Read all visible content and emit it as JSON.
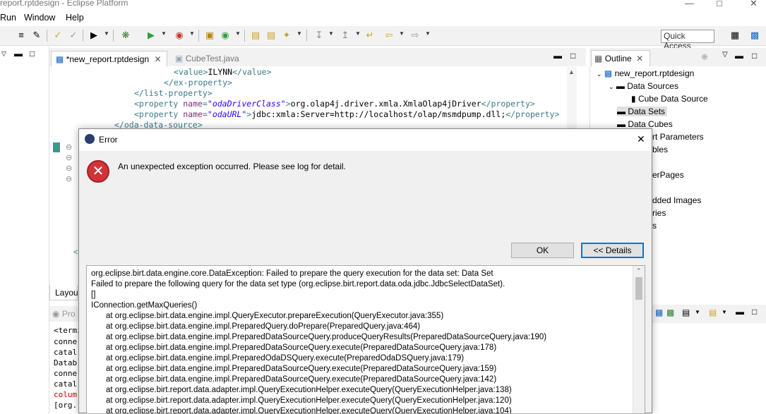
{
  "window": {
    "title": "report.rptdesign - Eclipse Platform",
    "minimize_icon": "minimize-icon",
    "restore_icon": "restore-icon",
    "close_icon": "close-icon"
  },
  "menu": {
    "items": [
      "Run",
      "Window",
      "Help"
    ]
  },
  "toolbar": {
    "quick_access": "Quick Access"
  },
  "editor": {
    "tabs": [
      {
        "label": "*new_report.rptdesign",
        "closable": true
      },
      {
        "label": "CubeTest.java",
        "closable": false
      }
    ],
    "code_lines": [
      {
        "parts": [
          [
            "tag",
            "<value>"
          ],
          [
            "txt",
            "ILYNN"
          ],
          [
            "tag",
            "</value>"
          ]
        ]
      },
      {
        "parts": [
          [
            "tag",
            "</ex-property>"
          ]
        ]
      },
      {
        "parts": [
          [
            "tag",
            "</list-property>"
          ]
        ]
      },
      {
        "parts": [
          [
            "tag",
            "<property "
          ],
          [
            "attr",
            "name"
          ],
          [
            "tag",
            "="
          ],
          [
            "aval",
            "\"odaDriverClass\""
          ],
          [
            "tag",
            ">"
          ],
          [
            "txt",
            "org.olap4j.driver.xmla.XmlaOlap4jDriver"
          ],
          [
            "tag",
            "</property>"
          ]
        ]
      },
      {
        "parts": [
          [
            "tag",
            "<property "
          ],
          [
            "attr",
            "name"
          ],
          [
            "tag",
            "="
          ],
          [
            "aval",
            "\"odaURL\""
          ],
          [
            "tag",
            ">"
          ],
          [
            "txt",
            "jdbc:xmla:Server=http://localhost/olap/msmdpump.dll;"
          ],
          [
            "tag",
            "</property>"
          ]
        ]
      },
      {
        "parts": [
          [
            "tag",
            "</oda-data-source>"
          ]
        ]
      }
    ],
    "bottom_tab": "Layou"
  },
  "outline": {
    "tab_label": "Outline",
    "items": [
      {
        "label": "new_report.rptdesign"
      },
      {
        "label": "Data Sources"
      },
      {
        "label": "Cube Data Source"
      },
      {
        "label": "Data Sets"
      },
      {
        "label": "Data Cubes"
      },
      {
        "label": "rt Parameters"
      },
      {
        "label": "bles"
      },
      {
        "label": "erPages"
      },
      {
        "label": "dded Images"
      },
      {
        "label": "ries"
      },
      {
        "label": "s"
      }
    ]
  },
  "console": {
    "tab_label": "Pro",
    "lines": [
      "<termi",
      "conne",
      "catal",
      "Datab",
      "conne",
      "catal",
      "colum",
      "[org."
    ]
  },
  "dialog": {
    "title": "Error",
    "message": "An unexpected exception occurred. Please see log for detail.",
    "ok_label": "OK",
    "details_label": "<< Details",
    "details_lines": [
      {
        "text": "org.eclipse.birt.data.engine.core.DataException: Failed to prepare the query execution for the data set: Data Set",
        "indent": false
      },
      {
        "text": "Failed to prepare the following query for the data set type (org.eclipse.birt.report.data.oda.jdbc.JdbcSelectDataSet).",
        "indent": false
      },
      {
        "text": "[]",
        "indent": false
      },
      {
        "text": "IConnection.getMaxQueries()",
        "indent": false
      },
      {
        "text": "at org.eclipse.birt.data.engine.impl.QueryExecutor.prepareExecution(QueryExecutor.java:355)",
        "indent": true
      },
      {
        "text": "at org.eclipse.birt.data.engine.impl.PreparedQuery.doPrepare(PreparedQuery.java:464)",
        "indent": true
      },
      {
        "text": "at org.eclipse.birt.data.engine.impl.PreparedDataSourceQuery.produceQueryResults(PreparedDataSourceQuery.java:190)",
        "indent": true
      },
      {
        "text": "at org.eclipse.birt.data.engine.impl.PreparedDataSourceQuery.execute(PreparedDataSourceQuery.java:178)",
        "indent": true
      },
      {
        "text": "at org.eclipse.birt.data.engine.impl.PreparedOdaDSQuery.execute(PreparedOdaDSQuery.java:179)",
        "indent": true
      },
      {
        "text": "at org.eclipse.birt.data.engine.impl.PreparedDataSourceQuery.execute(PreparedDataSourceQuery.java:159)",
        "indent": true
      },
      {
        "text": "at org.eclipse.birt.data.engine.impl.PreparedDataSourceQuery.execute(PreparedDataSourceQuery.java:142)",
        "indent": true
      },
      {
        "text": "at org.eclipse.birt.report.data.adapter.impl.QueryExecutionHelper.executeQuery(QueryExecutionHelper.java:138)",
        "indent": true
      },
      {
        "text": "at org.eclipse.birt.report.data.adapter.impl.QueryExecutionHelper.executeQuery(QueryExecutionHelper.java:120)",
        "indent": true
      },
      {
        "text": "at org.eclipse.birt.report.data.adapter.impl.QueryExecutionHelper.executeQuery(QueryExecutionHelper.java:104)",
        "indent": true
      }
    ]
  },
  "colors": {
    "error_red": "#d13438",
    "focus_blue": "#0078d7",
    "selection_gray": "#e0e0e0"
  }
}
